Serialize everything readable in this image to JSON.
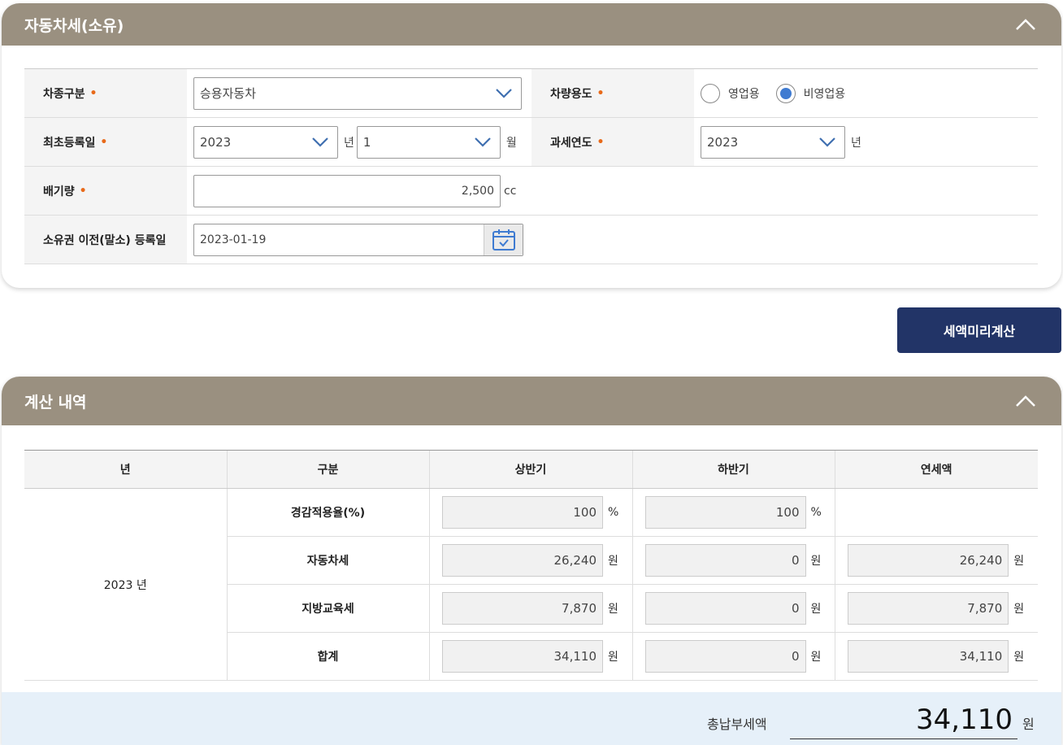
{
  "vehicle_panel": {
    "title": "자동차세(소유)",
    "vehicle_type": {
      "label": "차종구분",
      "value": "승용자동차"
    },
    "usage": {
      "label": "차량용도",
      "options": [
        "영업용",
        "비영업용"
      ],
      "selected": "비영업용"
    },
    "first_reg": {
      "label": "최초등록일",
      "year": "2023",
      "year_unit": "년",
      "month": "1",
      "month_unit": "월"
    },
    "tax_year": {
      "label": "과세연도",
      "value": "2023",
      "unit": "년"
    },
    "displacement": {
      "label": "배기량",
      "value": "2,500",
      "unit": "cc"
    },
    "transfer_date": {
      "label": "소유권 이전(말소) 등록일",
      "value": "2023-01-19"
    },
    "required_mark": "•"
  },
  "calc_button": "세액미리계산",
  "result_panel": {
    "title": "계산 내역",
    "headers": [
      "년",
      "구분",
      "상반기",
      "하반기",
      "연세액"
    ],
    "year_label": "2023 년",
    "rows": [
      {
        "category": "경감적용율(%)",
        "first_half": "100",
        "second_half": "100",
        "annual": "",
        "unit": "%"
      },
      {
        "category": "자동차세",
        "first_half": "26,240",
        "second_half": "0",
        "annual": "26,240",
        "unit": "원"
      },
      {
        "category": "지방교육세",
        "first_half": "7,870",
        "second_half": "0",
        "annual": "7,870",
        "unit": "원"
      },
      {
        "category": "합계",
        "first_half": "34,110",
        "second_half": "0",
        "annual": "34,110",
        "unit": "원"
      }
    ],
    "total_label": "총납부세액",
    "total_value": "34,110",
    "total_unit": "원"
  },
  "colors": {
    "header_bg": "#9a9080",
    "button_bg": "#223467",
    "accent": "#3f7bd1",
    "required": "#e86a1a",
    "total_bg": "#e6f0f9"
  }
}
